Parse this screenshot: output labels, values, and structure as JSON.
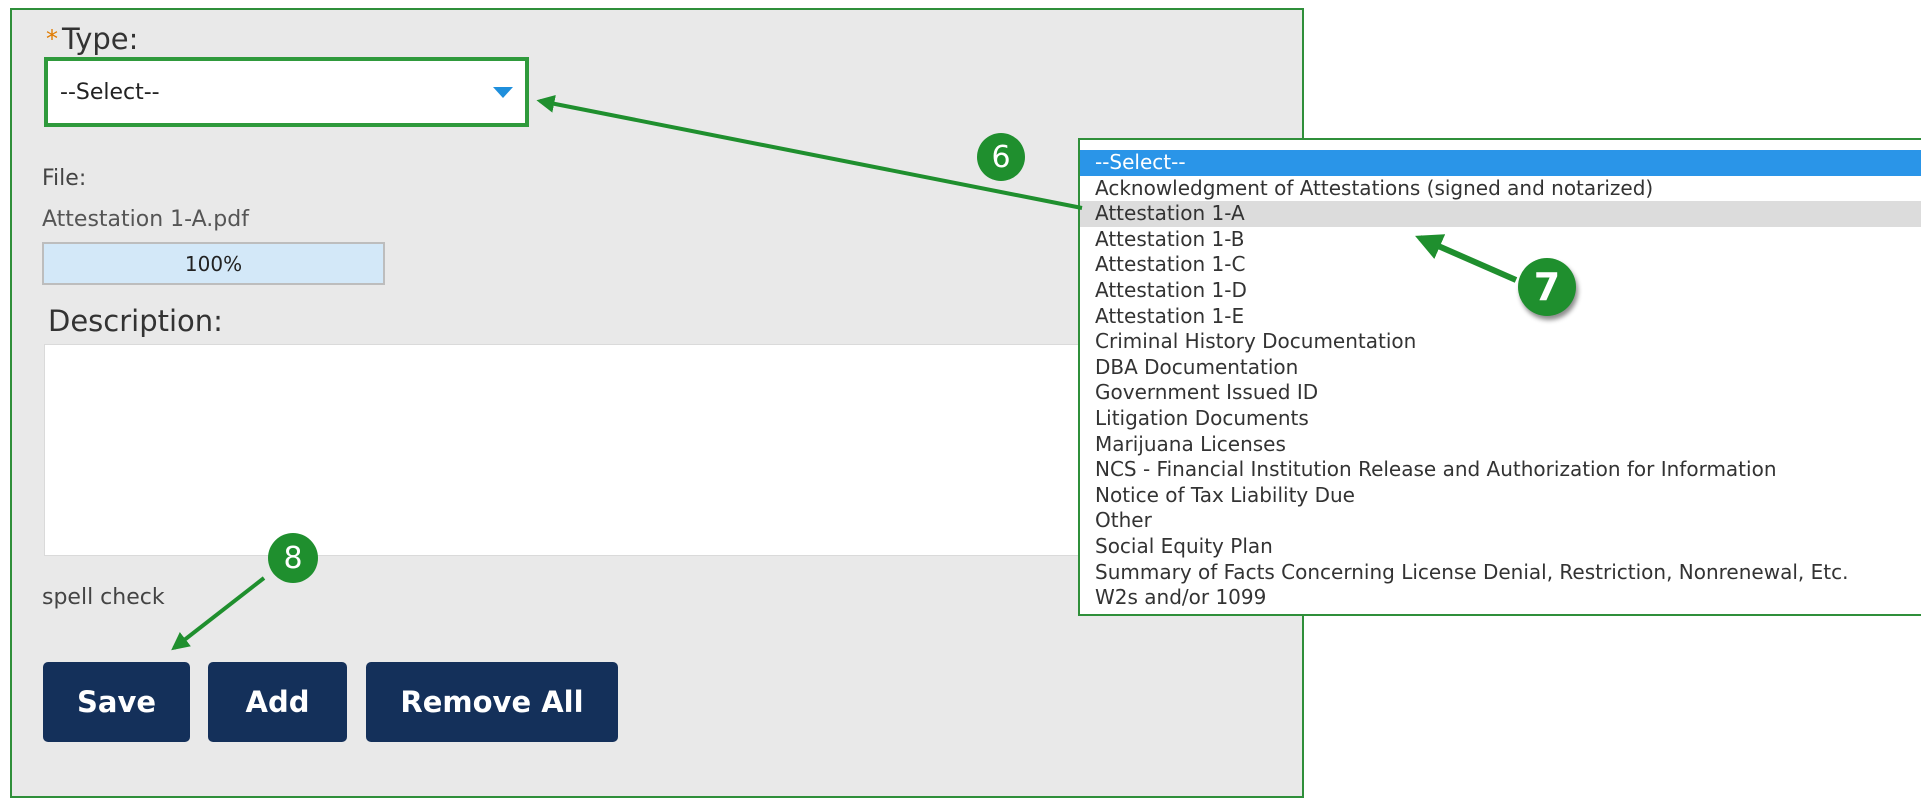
{
  "form": {
    "type_label": "Type:",
    "required_marker": "*",
    "type_select_value": "--Select--",
    "file_label": "File:",
    "file_name": "Attestation 1-A.pdf",
    "upload_progress_percent": 100,
    "upload_progress_text": "100%",
    "description_label": "Description:",
    "description_value": "",
    "spell_check_link": "spell check",
    "buttons": {
      "save": "Save",
      "add": "Add",
      "remove_all": "Remove All"
    }
  },
  "dropdown": {
    "selected_index": 0,
    "hover_index": 2,
    "options": [
      "--Select--",
      "Acknowledgment of Attestations (signed and notarized)",
      "Attestation 1-A",
      "Attestation 1-B",
      "Attestation 1-C",
      "Attestation 1-D",
      "Attestation 1-E",
      "Criminal History Documentation",
      "DBA Documentation",
      "Government Issued ID",
      "Litigation Documents",
      "Marijuana Licenses",
      "NCS - Financial Institution Release and Authorization for Information",
      "Notice of Tax Liability Due",
      "Other",
      "Social Equity Plan",
      "Summary of Facts Concerning License Denial, Restriction, Nonrenewal, Etc.",
      "W2s and/or 1099"
    ]
  },
  "annotations": {
    "step_6": "6",
    "step_7": "7",
    "step_8": "8",
    "color": "#1f8f2e"
  },
  "colors": {
    "button_bg": "#14305a",
    "select_border": "#2f9a3c",
    "dropdown_selected": "#2a95e8",
    "caret": "#1f8fdc",
    "required": "#e07b00"
  }
}
